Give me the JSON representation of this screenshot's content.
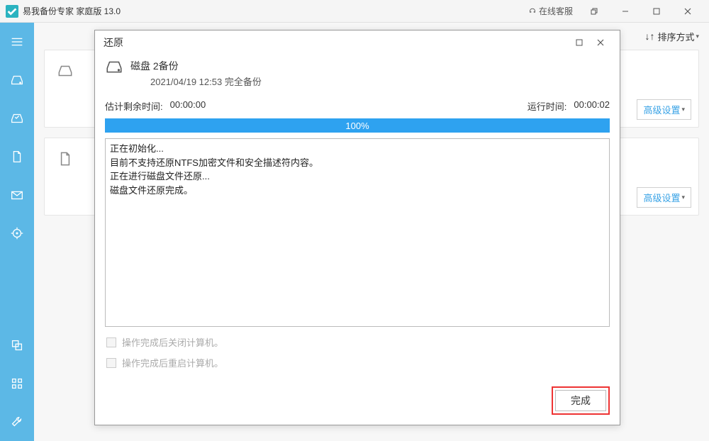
{
  "titlebar": {
    "title": "易我备份专家 家庭版 13.0",
    "online_service": "在线客服"
  },
  "topbar": {
    "sort_label": "排序方式"
  },
  "cards": {
    "advanced_label": "高级设置"
  },
  "modal": {
    "title": "还原",
    "job_title": "磁盘 2备份",
    "job_subtitle": "2021/04/19 12:53 完全备份",
    "est_label": "估计剩余时间:",
    "est_value": "00:00:00",
    "run_label": "运行时间:",
    "run_value": "00:00:02",
    "progress_text": "100%",
    "log": [
      "正在初始化...",
      "目前不支持还原NTFS加密文件和安全描述符内容。",
      "正在进行磁盘文件还原...",
      "磁盘文件还原完成。"
    ],
    "check_shutdown": "操作完成后关闭计算机。",
    "check_restart": "操作完成后重启计算机。",
    "finish_label": "完成"
  }
}
